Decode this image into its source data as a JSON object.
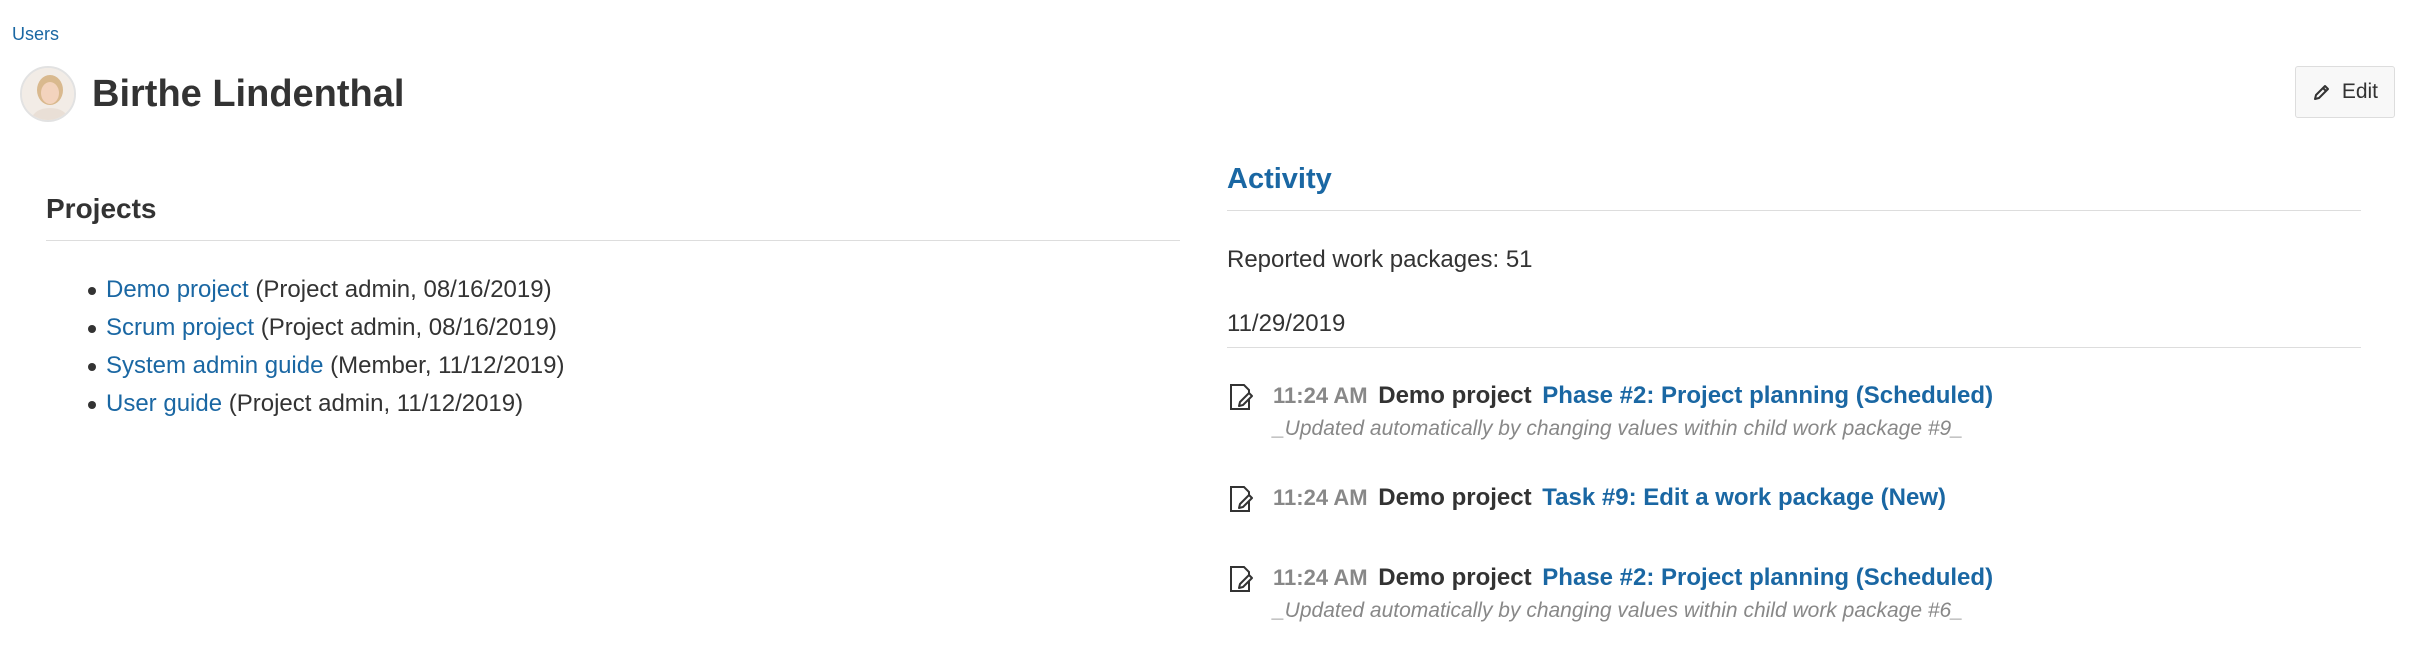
{
  "breadcrumb": {
    "label": "Users"
  },
  "header": {
    "title": "Birthe Lindenthal",
    "edit_label": "Edit"
  },
  "projects": {
    "title": "Projects",
    "items": [
      {
        "name": "Demo project",
        "details": "(Project admin, 08/16/2019)"
      },
      {
        "name": "Scrum project",
        "details": "(Project admin, 08/16/2019)"
      },
      {
        "name": "System admin guide",
        "details": "(Member, 11/12/2019)"
      },
      {
        "name": "User guide",
        "details": "(Project admin, 11/12/2019)"
      }
    ]
  },
  "activity": {
    "title": "Activity",
    "reported": "Reported work packages: 51",
    "date": "11/29/2019",
    "items": [
      {
        "time": "11:24 AM",
        "project": "Demo project",
        "link": "Phase #2: Project planning (Scheduled)",
        "description": "_Updated automatically by changing values within child work package #9_"
      },
      {
        "time": "11:24 AM",
        "project": "Demo project",
        "link": "Task #9: Edit a work package (New)",
        "description": ""
      },
      {
        "time": "11:24 AM",
        "project": "Demo project",
        "link": "Phase #2: Project planning (Scheduled)",
        "description": "_Updated automatically by changing values within child work package #6_"
      }
    ]
  },
  "colors": {
    "link": "#1a67a3",
    "text": "#333333",
    "muted": "#888888",
    "divider": "#dddddd"
  }
}
